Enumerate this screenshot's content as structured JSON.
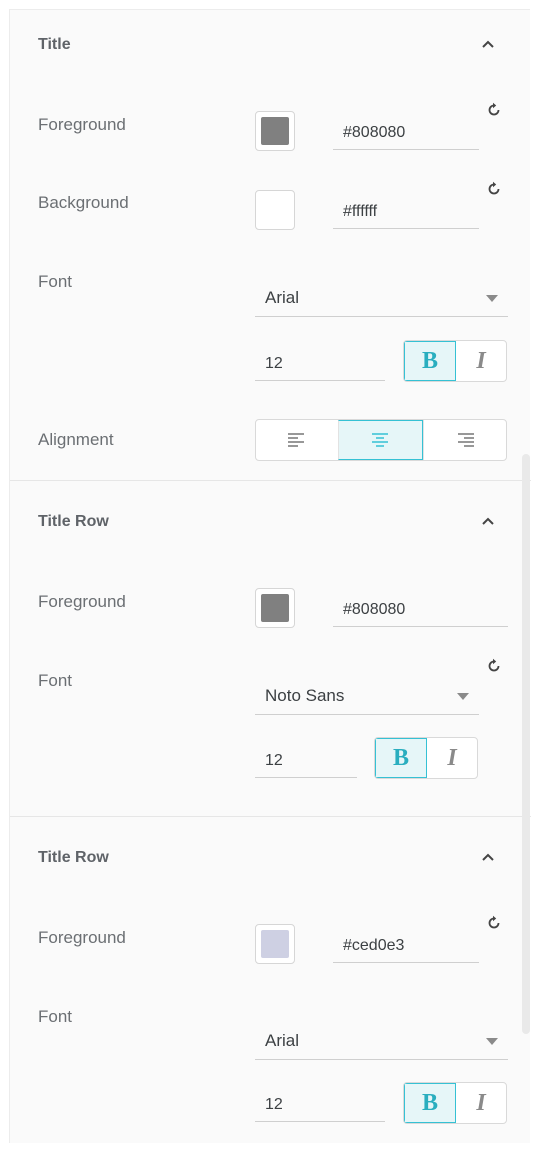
{
  "sections": [
    {
      "title": "Title",
      "foreground": {
        "label": "Foreground",
        "value": "#808080",
        "color": "#808080"
      },
      "background": {
        "label": "Background",
        "value": "#ffffff",
        "color": "#ffffff"
      },
      "font": {
        "label": "Font",
        "family": "Arial",
        "size": "12",
        "bold": "B",
        "italic": "I"
      },
      "alignment": {
        "label": "Alignment",
        "options": [
          "left",
          "center",
          "right"
        ],
        "selected": "center"
      }
    },
    {
      "title": "Title Row",
      "foreground": {
        "label": "Foreground",
        "value": "#808080",
        "color": "#808080"
      },
      "font": {
        "label": "Font",
        "family": "Noto Sans",
        "size": "12",
        "bold": "B",
        "italic": "I"
      }
    },
    {
      "title": "Title Row",
      "foreground": {
        "label": "Foreground",
        "value": "#ced0e3",
        "color": "#ced0e3"
      },
      "font": {
        "label": "Font",
        "family": "Arial",
        "size": "12",
        "bold": "B",
        "italic": "I"
      }
    }
  ],
  "colors": {
    "accent": "#35c1d4",
    "accent_bg": "#e6f6f8"
  },
  "icons": {
    "collapse": "chevron-up-icon",
    "reset": "reset-icon"
  }
}
